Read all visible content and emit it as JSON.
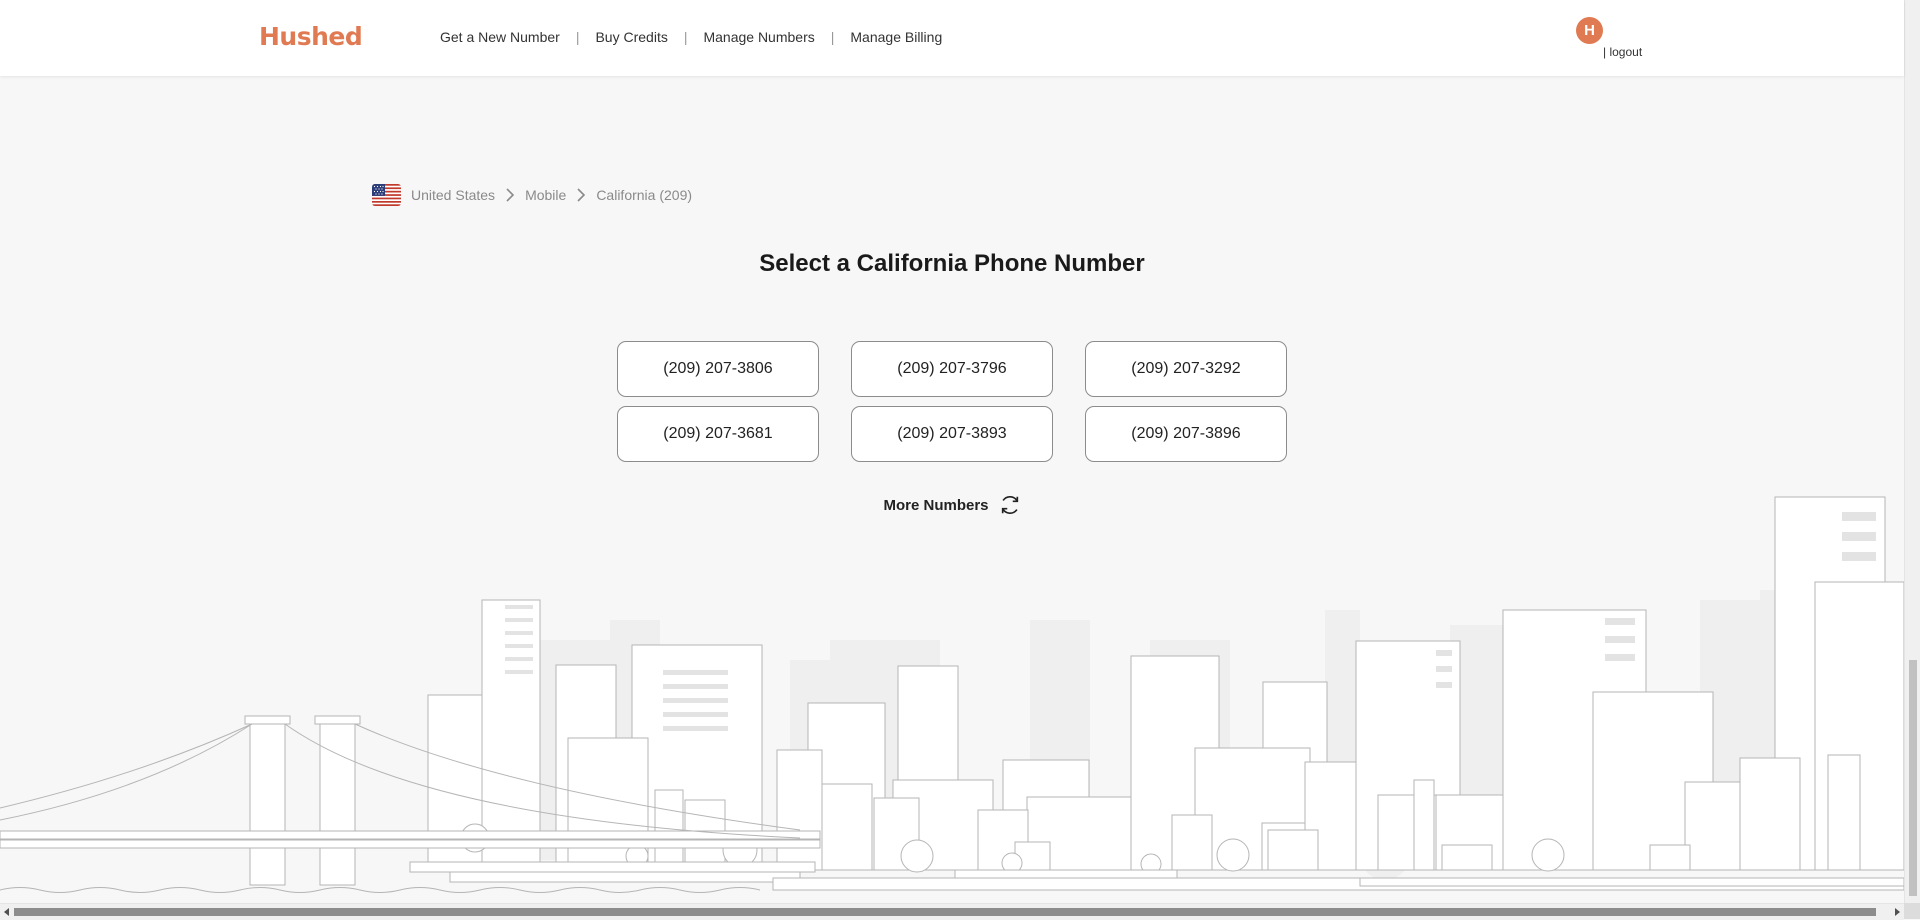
{
  "header": {
    "logo": "Hushed",
    "nav": [
      {
        "label": "Get a New Number"
      },
      {
        "label": "Buy Credits"
      },
      {
        "label": "Manage Numbers"
      },
      {
        "label": "Manage Billing"
      }
    ],
    "avatar_initial": "H",
    "logout_label": "| logout"
  },
  "breadcrumb": {
    "flag_icon": "us-flag-icon",
    "items": [
      "United States",
      "Mobile",
      "California (209)"
    ]
  },
  "title": "Select a California Phone Number",
  "numbers": [
    "(209) 207-3806",
    "(209) 207-3796",
    "(209) 207-3292",
    "(209) 207-3681",
    "(209) 207-3893",
    "(209) 207-3896"
  ],
  "more_numbers": {
    "label": "More Numbers",
    "icon": "refresh-icon"
  },
  "colors": {
    "brand": "#e07a52",
    "background": "#f7f7f7",
    "button_border": "#8c8c8c"
  }
}
